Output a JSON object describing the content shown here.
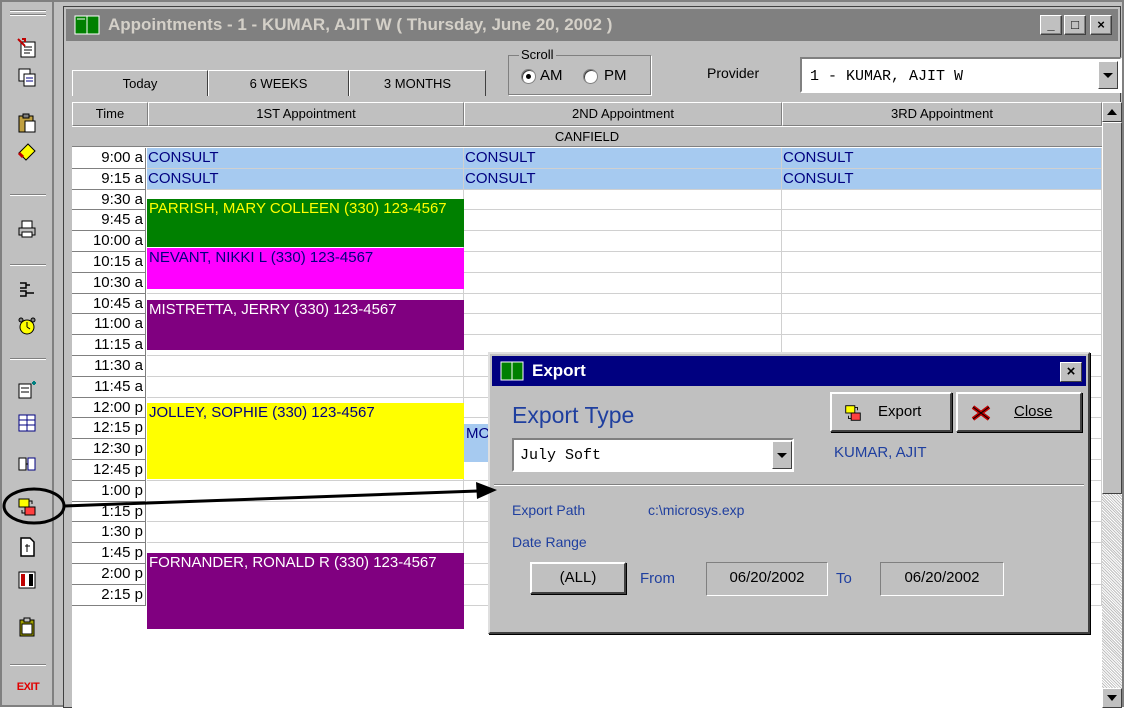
{
  "window": {
    "title": "Appointments - 1 - KUMAR, AJIT W  ( Thursday, June 20, 2002 )",
    "min": "_",
    "max": "□",
    "close": "×"
  },
  "nav": {
    "today": "Today",
    "six_weeks": "6 WEEKS",
    "three_months": "3 MONTHS",
    "scroll_label": "Scroll",
    "am": "AM",
    "pm": "PM",
    "provider_label": "Provider",
    "provider_value": "1 - KUMAR, AJIT W"
  },
  "grid": {
    "headers": [
      "Time",
      "1ST Appointment",
      "2ND Appointment",
      "3RD Appointment"
    ],
    "location": "CANFIELD",
    "times": [
      "9:00 a",
      "9:15 a",
      "9:30 a",
      "9:45 a",
      "10:00 a",
      "10:15 a",
      "10:30 a",
      "10:45 a",
      "11:00 a",
      "11:15 a",
      "11:30 a",
      "11:45 a",
      "12:00 p",
      "12:15 p",
      "12:30 p",
      "12:45 p",
      "1:00 p",
      "1:15 p",
      "1:30 p",
      "1:45 p",
      "2:00 p",
      "2:15 p"
    ],
    "consult": [
      "CONSULT",
      "CONSULT",
      "CONSULT",
      "CONSULT",
      "CONSULT",
      "CONSULT"
    ],
    "appointments": [
      {
        "label": "PARRISH, MARY COLLEEN   (330) 123-4567",
        "color": "#008000",
        "text_color": "#ffff00"
      },
      {
        "label": "NEVANT, NIKKI L  (330) 123-4567",
        "color": "#ff00ff",
        "text_color": "#000080"
      },
      {
        "label": "MISTRETTA, JERRY   (330) 123-4567",
        "color": "#800080",
        "text_color": "#ffffff"
      },
      {
        "label": "JOLLEY, SOPHIE   (330) 123-4567",
        "color": "#ffff00",
        "text_color": "#000080"
      },
      {
        "label": "MO",
        "color": "#a6caf0",
        "text_color": "#000080"
      },
      {
        "label": "FORNANDER, RONALD  R  (330) 123-4567",
        "color": "#800080",
        "text_color": "#ffffff"
      }
    ],
    "consult_color": "#a6caf0"
  },
  "dialog": {
    "title": "Export",
    "close": "×",
    "export_type_label": "Export Type",
    "export_type_value": "July Soft",
    "export_button": "Export",
    "close_button": "Close",
    "provider": "KUMAR, AJIT",
    "export_path_label": "Export Path",
    "export_path_value": "c:\\microsys.exp",
    "date_range_label": "Date Range",
    "all_button": "(ALL)",
    "from_label": "From",
    "from_value": "06/20/2002",
    "to_label": "To",
    "to_value": "06/20/2002"
  },
  "toolbar": {
    "exit": "EXIT",
    "icons": [
      "new-appointment-icon",
      "copy-icon",
      "paste-icon",
      "eraser-icon",
      "print-icon",
      "tree-icon",
      "alarm-clock-icon",
      "schedule-icon",
      "grid-icon",
      "export-icon",
      "document-icon",
      "book-icon",
      "clipboard-icon"
    ]
  }
}
